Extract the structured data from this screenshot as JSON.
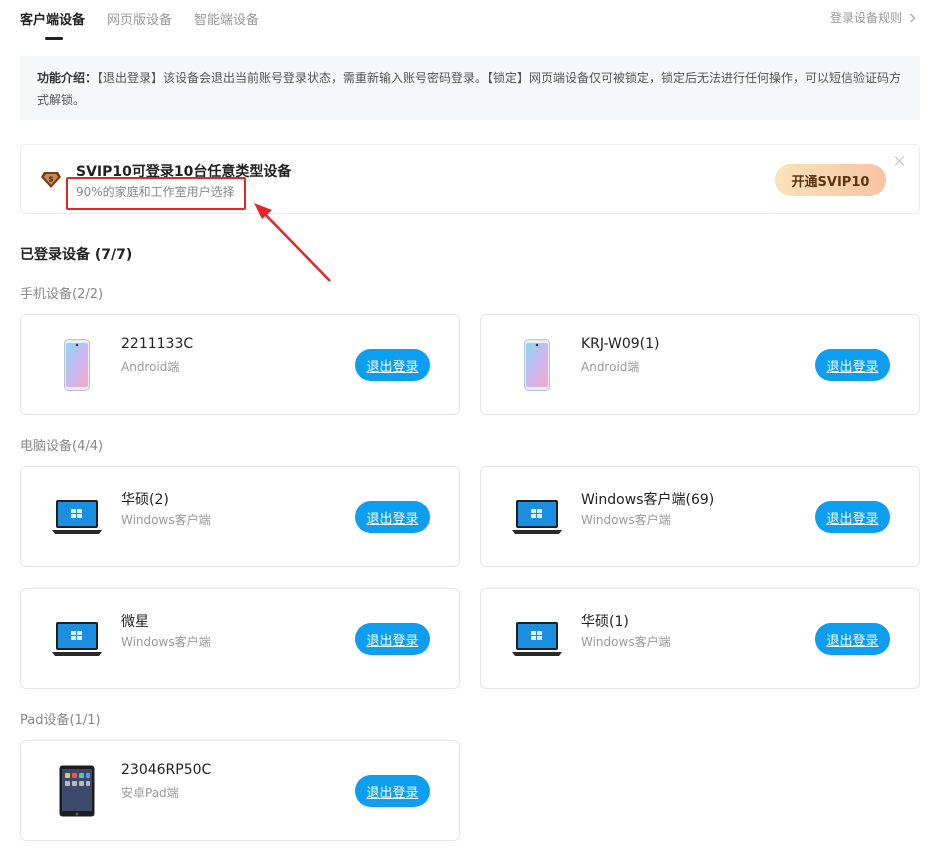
{
  "tabs": [
    {
      "label": "客户端设备",
      "active": true
    },
    {
      "label": "网页版设备",
      "active": false
    },
    {
      "label": "智能端设备",
      "active": false
    }
  ],
  "rules_link": "登录设备规则",
  "intro": {
    "label": "功能介绍：",
    "text": "【退出登录】该设备会退出当前账号登录状态，需重新输入账号密码登录。【锁定】网页端设备仅可被锁定，锁定后无法进行任何操作，可以短信验证码方式解锁。"
  },
  "banner": {
    "title": "SVIP10可登录10台任意类型设备",
    "subtitle": "90%的家庭和工作室用户选择",
    "button": "开通SVIP10",
    "badge": "S",
    "colors": {
      "highlight": "#e3262b"
    }
  },
  "logged_in_title": "已登录设备 (7/7)",
  "groups": {
    "phone": {
      "title": "手机设备(2/2)",
      "devices": [
        {
          "name": "2211133C",
          "type": "Android端",
          "icon": "phone-icon",
          "button": "退出登录"
        },
        {
          "name": "KRJ-W09(1)",
          "type": "Android端",
          "icon": "phone-icon",
          "button": "退出登录"
        }
      ]
    },
    "pc": {
      "title": "电脑设备(4/4)",
      "devices": [
        {
          "name": "华硕(2)",
          "type": "Windows客户端",
          "icon": "laptop-icon",
          "button": "退出登录"
        },
        {
          "name": "Windows客户端(69)",
          "type": "Windows客户端",
          "icon": "laptop-icon",
          "button": "退出登录"
        },
        {
          "name": "微星",
          "type": "Windows客户端",
          "icon": "laptop-icon",
          "button": "退出登录"
        },
        {
          "name": "华硕(1)",
          "type": "Windows客户端",
          "icon": "laptop-icon",
          "button": "退出登录"
        }
      ]
    },
    "pad": {
      "title": "Pad设备(1/1)",
      "devices": [
        {
          "name": "23046RP50C",
          "type": "安卓Pad端",
          "icon": "tablet-icon",
          "button": "退出登录"
        }
      ]
    }
  },
  "colors": {
    "accent": "#0e9ef0",
    "vip_gradient_start": "#fbe3b8",
    "vip_gradient_end": "#f7c3a4"
  }
}
